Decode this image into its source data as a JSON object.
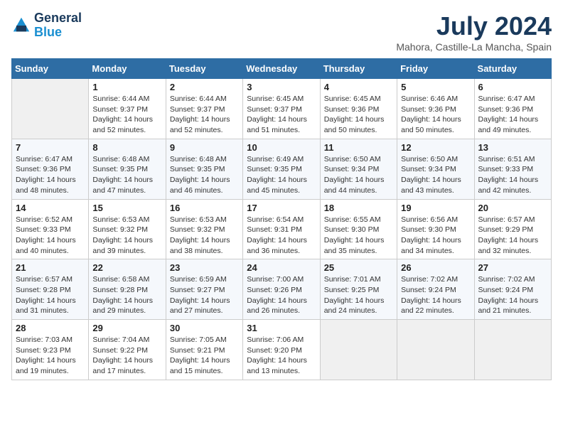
{
  "logo": {
    "name_line1": "General",
    "name_line2": "Blue"
  },
  "title": "July 2024",
  "subtitle": "Mahora, Castille-La Mancha, Spain",
  "weekdays": [
    "Sunday",
    "Monday",
    "Tuesday",
    "Wednesday",
    "Thursday",
    "Friday",
    "Saturday"
  ],
  "weeks": [
    [
      {
        "day": "",
        "sunrise": "",
        "sunset": "",
        "daylight": ""
      },
      {
        "day": "1",
        "sunrise": "Sunrise: 6:44 AM",
        "sunset": "Sunset: 9:37 PM",
        "daylight": "Daylight: 14 hours and 52 minutes."
      },
      {
        "day": "2",
        "sunrise": "Sunrise: 6:44 AM",
        "sunset": "Sunset: 9:37 PM",
        "daylight": "Daylight: 14 hours and 52 minutes."
      },
      {
        "day": "3",
        "sunrise": "Sunrise: 6:45 AM",
        "sunset": "Sunset: 9:37 PM",
        "daylight": "Daylight: 14 hours and 51 minutes."
      },
      {
        "day": "4",
        "sunrise": "Sunrise: 6:45 AM",
        "sunset": "Sunset: 9:36 PM",
        "daylight": "Daylight: 14 hours and 50 minutes."
      },
      {
        "day": "5",
        "sunrise": "Sunrise: 6:46 AM",
        "sunset": "Sunset: 9:36 PM",
        "daylight": "Daylight: 14 hours and 50 minutes."
      },
      {
        "day": "6",
        "sunrise": "Sunrise: 6:47 AM",
        "sunset": "Sunset: 9:36 PM",
        "daylight": "Daylight: 14 hours and 49 minutes."
      }
    ],
    [
      {
        "day": "7",
        "sunrise": "Sunrise: 6:47 AM",
        "sunset": "Sunset: 9:36 PM",
        "daylight": "Daylight: 14 hours and 48 minutes."
      },
      {
        "day": "8",
        "sunrise": "Sunrise: 6:48 AM",
        "sunset": "Sunset: 9:35 PM",
        "daylight": "Daylight: 14 hours and 47 minutes."
      },
      {
        "day": "9",
        "sunrise": "Sunrise: 6:48 AM",
        "sunset": "Sunset: 9:35 PM",
        "daylight": "Daylight: 14 hours and 46 minutes."
      },
      {
        "day": "10",
        "sunrise": "Sunrise: 6:49 AM",
        "sunset": "Sunset: 9:35 PM",
        "daylight": "Daylight: 14 hours and 45 minutes."
      },
      {
        "day": "11",
        "sunrise": "Sunrise: 6:50 AM",
        "sunset": "Sunset: 9:34 PM",
        "daylight": "Daylight: 14 hours and 44 minutes."
      },
      {
        "day": "12",
        "sunrise": "Sunrise: 6:50 AM",
        "sunset": "Sunset: 9:34 PM",
        "daylight": "Daylight: 14 hours and 43 minutes."
      },
      {
        "day": "13",
        "sunrise": "Sunrise: 6:51 AM",
        "sunset": "Sunset: 9:33 PM",
        "daylight": "Daylight: 14 hours and 42 minutes."
      }
    ],
    [
      {
        "day": "14",
        "sunrise": "Sunrise: 6:52 AM",
        "sunset": "Sunset: 9:33 PM",
        "daylight": "Daylight: 14 hours and 40 minutes."
      },
      {
        "day": "15",
        "sunrise": "Sunrise: 6:53 AM",
        "sunset": "Sunset: 9:32 PM",
        "daylight": "Daylight: 14 hours and 39 minutes."
      },
      {
        "day": "16",
        "sunrise": "Sunrise: 6:53 AM",
        "sunset": "Sunset: 9:32 PM",
        "daylight": "Daylight: 14 hours and 38 minutes."
      },
      {
        "day": "17",
        "sunrise": "Sunrise: 6:54 AM",
        "sunset": "Sunset: 9:31 PM",
        "daylight": "Daylight: 14 hours and 36 minutes."
      },
      {
        "day": "18",
        "sunrise": "Sunrise: 6:55 AM",
        "sunset": "Sunset: 9:30 PM",
        "daylight": "Daylight: 14 hours and 35 minutes."
      },
      {
        "day": "19",
        "sunrise": "Sunrise: 6:56 AM",
        "sunset": "Sunset: 9:30 PM",
        "daylight": "Daylight: 14 hours and 34 minutes."
      },
      {
        "day": "20",
        "sunrise": "Sunrise: 6:57 AM",
        "sunset": "Sunset: 9:29 PM",
        "daylight": "Daylight: 14 hours and 32 minutes."
      }
    ],
    [
      {
        "day": "21",
        "sunrise": "Sunrise: 6:57 AM",
        "sunset": "Sunset: 9:28 PM",
        "daylight": "Daylight: 14 hours and 31 minutes."
      },
      {
        "day": "22",
        "sunrise": "Sunrise: 6:58 AM",
        "sunset": "Sunset: 9:28 PM",
        "daylight": "Daylight: 14 hours and 29 minutes."
      },
      {
        "day": "23",
        "sunrise": "Sunrise: 6:59 AM",
        "sunset": "Sunset: 9:27 PM",
        "daylight": "Daylight: 14 hours and 27 minutes."
      },
      {
        "day": "24",
        "sunrise": "Sunrise: 7:00 AM",
        "sunset": "Sunset: 9:26 PM",
        "daylight": "Daylight: 14 hours and 26 minutes."
      },
      {
        "day": "25",
        "sunrise": "Sunrise: 7:01 AM",
        "sunset": "Sunset: 9:25 PM",
        "daylight": "Daylight: 14 hours and 24 minutes."
      },
      {
        "day": "26",
        "sunrise": "Sunrise: 7:02 AM",
        "sunset": "Sunset: 9:24 PM",
        "daylight": "Daylight: 14 hours and 22 minutes."
      },
      {
        "day": "27",
        "sunrise": "Sunrise: 7:02 AM",
        "sunset": "Sunset: 9:24 PM",
        "daylight": "Daylight: 14 hours and 21 minutes."
      }
    ],
    [
      {
        "day": "28",
        "sunrise": "Sunrise: 7:03 AM",
        "sunset": "Sunset: 9:23 PM",
        "daylight": "Daylight: 14 hours and 19 minutes."
      },
      {
        "day": "29",
        "sunrise": "Sunrise: 7:04 AM",
        "sunset": "Sunset: 9:22 PM",
        "daylight": "Daylight: 14 hours and 17 minutes."
      },
      {
        "day": "30",
        "sunrise": "Sunrise: 7:05 AM",
        "sunset": "Sunset: 9:21 PM",
        "daylight": "Daylight: 14 hours and 15 minutes."
      },
      {
        "day": "31",
        "sunrise": "Sunrise: 7:06 AM",
        "sunset": "Sunset: 9:20 PM",
        "daylight": "Daylight: 14 hours and 13 minutes."
      },
      {
        "day": "",
        "sunrise": "",
        "sunset": "",
        "daylight": ""
      },
      {
        "day": "",
        "sunrise": "",
        "sunset": "",
        "daylight": ""
      },
      {
        "day": "",
        "sunrise": "",
        "sunset": "",
        "daylight": ""
      }
    ]
  ]
}
